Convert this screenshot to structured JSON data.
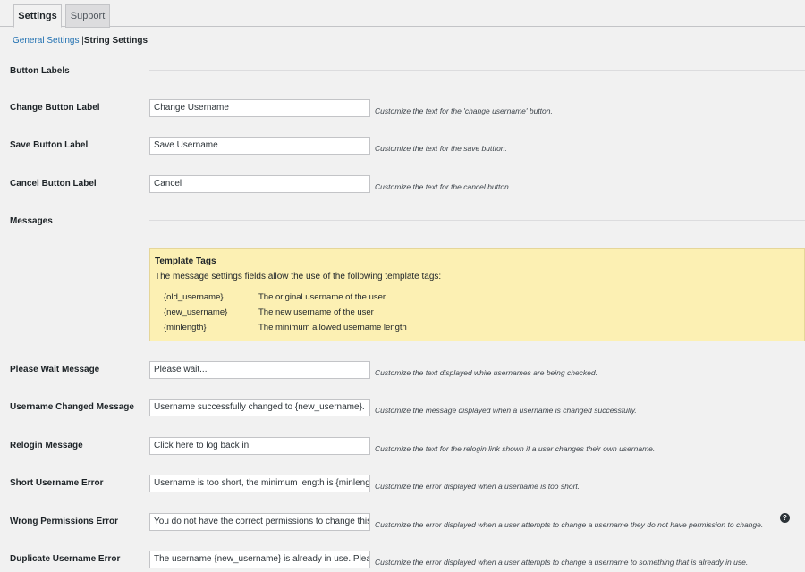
{
  "tabs": [
    {
      "label": "Settings",
      "active": true
    },
    {
      "label": "Support",
      "active": false
    }
  ],
  "subnav": {
    "general": "General Settings",
    "separator": "|",
    "current": "String Settings"
  },
  "sections": {
    "button_labels": "Button Labels",
    "messages": "Messages"
  },
  "fields": [
    {
      "label": "Change Button Label",
      "value": "Change Username",
      "description": "Customize the text for the 'change username' button."
    },
    {
      "label": "Save Button Label",
      "value": "Save Username",
      "description": "Customize the text for the save buttton."
    },
    {
      "label": "Cancel Button Label",
      "value": "Cancel",
      "description": "Customize the text for the cancel button."
    },
    {
      "label": "Please Wait Message",
      "value": "Please wait...",
      "description": "Customize the text displayed while usernames are being checked."
    },
    {
      "label": "Username Changed Message",
      "value": "Username successfully changed to {new_username}.",
      "description": "Customize the message displayed when a username is changed successfully."
    },
    {
      "label": "Relogin Message",
      "value": "Click here to log back in.",
      "description": "Customize the text for the relogin link shown if a user changes their own username."
    },
    {
      "label": "Short Username Error",
      "value": "Username is too short, the minimum length is {minlength}.",
      "description": "Customize the error displayed when a username is too short."
    },
    {
      "label": "Wrong Permissions Error",
      "value": "You do not have the correct permissions to change this username.",
      "description": "Customize the error displayed when a user attempts to change a username they do not have permission to change."
    },
    {
      "label": "Duplicate Username Error",
      "value": "The username {new_username} is already in use. Please try again.",
      "description": "Customize the error displayed when a user attempts to change a username to something that is already in use."
    }
  ],
  "template_tags": {
    "title": "Template Tags",
    "intro": "The message settings fields allow the use of the following template tags:",
    "tags": [
      {
        "tag": "{old_username}",
        "description": "The original username of the user"
      },
      {
        "tag": "{new_username}",
        "description": "The new username of the user"
      },
      {
        "tag": "{minlength}",
        "description": "The minimum allowed username length"
      }
    ]
  },
  "help_icon": {
    "icon": "help-icon",
    "glyph": "?"
  }
}
